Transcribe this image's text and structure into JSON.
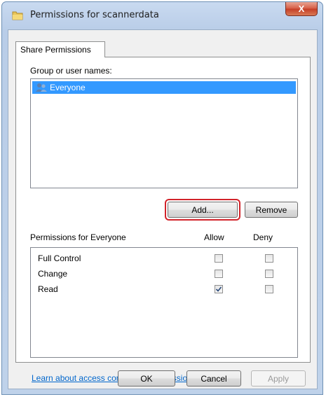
{
  "window": {
    "title": "Permissions for scannerdata",
    "close_glyph": "X"
  },
  "tab": {
    "label": "Share Permissions"
  },
  "group_section": {
    "label": "Group or user names:",
    "items": [
      {
        "name": "Everyone",
        "selected": true
      }
    ]
  },
  "buttons": {
    "add": "Add...",
    "remove": "Remove",
    "ok": "OK",
    "cancel": "Cancel",
    "apply": "Apply"
  },
  "permissions": {
    "header": "Permissions for Everyone",
    "allow_header": "Allow",
    "deny_header": "Deny",
    "rows": [
      {
        "name": "Full Control",
        "allow": false,
        "deny": false
      },
      {
        "name": "Change",
        "allow": false,
        "deny": false
      },
      {
        "name": "Read",
        "allow": true,
        "deny": false
      }
    ]
  },
  "link": {
    "text": "Learn about access control and permissions"
  },
  "colors": {
    "selection": "#3399ff",
    "highlight_outline": "#d2232a",
    "link": "#0066cc"
  }
}
